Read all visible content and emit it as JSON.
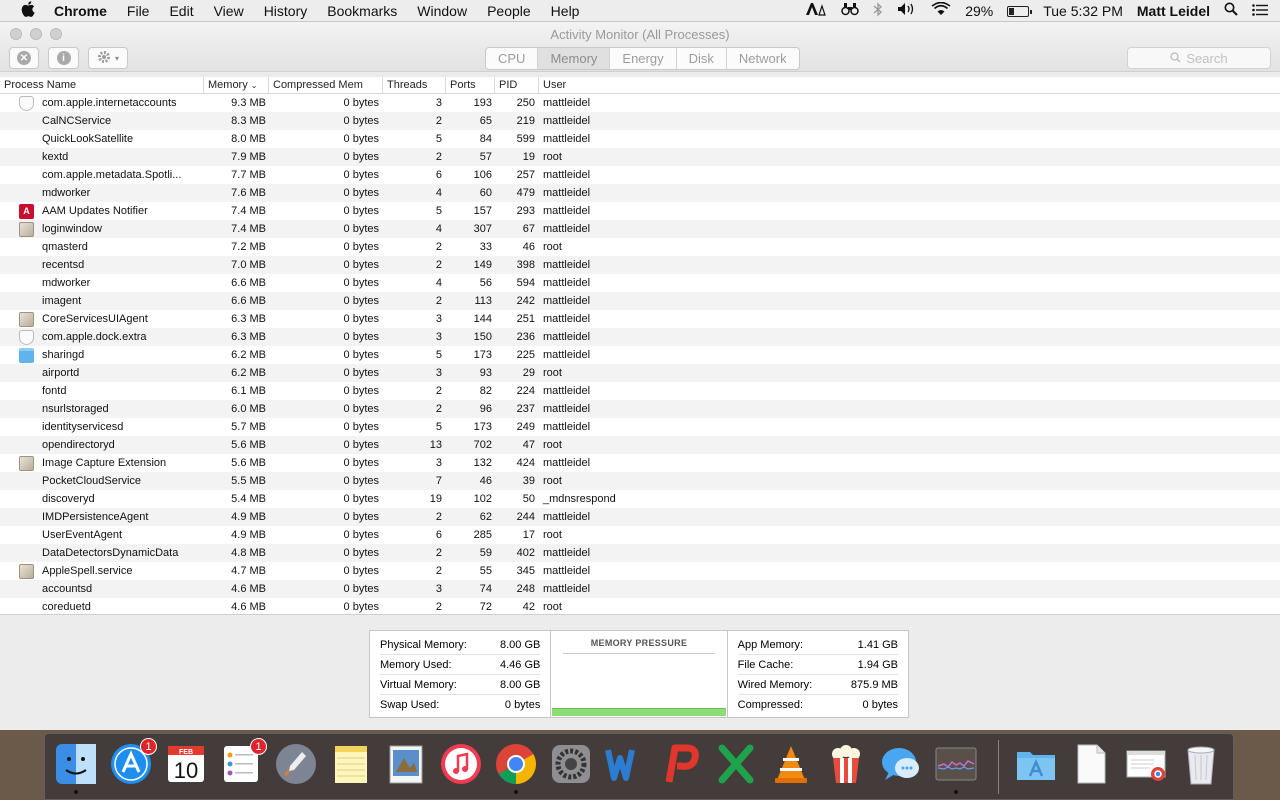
{
  "menubar": {
    "app": "Chrome",
    "items": [
      "File",
      "Edit",
      "View",
      "History",
      "Bookmarks",
      "Window",
      "People",
      "Help"
    ],
    "battery": "29%",
    "battery_level": 0.29,
    "clock": "Tue 5:32 PM",
    "user": "Matt Leidel"
  },
  "window": {
    "title": "Activity Monitor (All Processes)",
    "tabs": [
      "CPU",
      "Memory",
      "Energy",
      "Disk",
      "Network"
    ],
    "active_tab": "Memory",
    "search_placeholder": "Search"
  },
  "table": {
    "columns": {
      "process": "Process Name",
      "memory": "Memory",
      "compressed": "Compressed Mem",
      "threads": "Threads",
      "ports": "Ports",
      "pid": "PID",
      "user": "User"
    },
    "rows": [
      {
        "icon": "shield-icon",
        "name": "com.apple.internetaccounts",
        "memory": "9.3 MB",
        "compressed": "0 bytes",
        "threads": "3",
        "ports": "193",
        "pid": "250",
        "user": "mattleidel"
      },
      {
        "icon": "",
        "name": "CalNCService",
        "memory": "8.3 MB",
        "compressed": "0 bytes",
        "threads": "2",
        "ports": "65",
        "pid": "219",
        "user": "mattleidel"
      },
      {
        "icon": "",
        "name": "QuickLookSatellite",
        "memory": "8.0 MB",
        "compressed": "0 bytes",
        "threads": "5",
        "ports": "84",
        "pid": "599",
        "user": "mattleidel"
      },
      {
        "icon": "",
        "name": "kextd",
        "memory": "7.9 MB",
        "compressed": "0 bytes",
        "threads": "2",
        "ports": "57",
        "pid": "19",
        "user": "root"
      },
      {
        "icon": "",
        "name": "com.apple.metadata.Spotli...",
        "memory": "7.7 MB",
        "compressed": "0 bytes",
        "threads": "6",
        "ports": "106",
        "pid": "257",
        "user": "mattleidel"
      },
      {
        "icon": "",
        "name": "mdworker",
        "memory": "7.6 MB",
        "compressed": "0 bytes",
        "threads": "4",
        "ports": "60",
        "pid": "479",
        "user": "mattleidel"
      },
      {
        "icon": "adobe-icon",
        "name": "AAM Updates Notifier",
        "memory": "7.4 MB",
        "compressed": "0 bytes",
        "threads": "5",
        "ports": "157",
        "pid": "293",
        "user": "mattleidel"
      },
      {
        "icon": "app-icon",
        "name": "loginwindow",
        "memory": "7.4 MB",
        "compressed": "0 bytes",
        "threads": "4",
        "ports": "307",
        "pid": "67",
        "user": "mattleidel"
      },
      {
        "icon": "",
        "name": "qmasterd",
        "memory": "7.2 MB",
        "compressed": "0 bytes",
        "threads": "2",
        "ports": "33",
        "pid": "46",
        "user": "root"
      },
      {
        "icon": "",
        "name": "recentsd",
        "memory": "7.0 MB",
        "compressed": "0 bytes",
        "threads": "2",
        "ports": "149",
        "pid": "398",
        "user": "mattleidel"
      },
      {
        "icon": "",
        "name": "mdworker",
        "memory": "6.6 MB",
        "compressed": "0 bytes",
        "threads": "4",
        "ports": "56",
        "pid": "594",
        "user": "mattleidel"
      },
      {
        "icon": "",
        "name": "imagent",
        "memory": "6.6 MB",
        "compressed": "0 bytes",
        "threads": "2",
        "ports": "113",
        "pid": "242",
        "user": "mattleidel"
      },
      {
        "icon": "app-icon",
        "name": "CoreServicesUIAgent",
        "memory": "6.3 MB",
        "compressed": "0 bytes",
        "threads": "3",
        "ports": "144",
        "pid": "251",
        "user": "mattleidel"
      },
      {
        "icon": "shield-icon",
        "name": "com.apple.dock.extra",
        "memory": "6.3 MB",
        "compressed": "0 bytes",
        "threads": "3",
        "ports": "150",
        "pid": "236",
        "user": "mattleidel"
      },
      {
        "icon": "folder-icon",
        "name": "sharingd",
        "memory": "6.2 MB",
        "compressed": "0 bytes",
        "threads": "5",
        "ports": "173",
        "pid": "225",
        "user": "mattleidel"
      },
      {
        "icon": "",
        "name": "airportd",
        "memory": "6.2 MB",
        "compressed": "0 bytes",
        "threads": "3",
        "ports": "93",
        "pid": "29",
        "user": "root"
      },
      {
        "icon": "",
        "name": "fontd",
        "memory": "6.1 MB",
        "compressed": "0 bytes",
        "threads": "2",
        "ports": "82",
        "pid": "224",
        "user": "mattleidel"
      },
      {
        "icon": "",
        "name": "nsurlstoraged",
        "memory": "6.0 MB",
        "compressed": "0 bytes",
        "threads": "2",
        "ports": "96",
        "pid": "237",
        "user": "mattleidel"
      },
      {
        "icon": "",
        "name": "identityservicesd",
        "memory": "5.7 MB",
        "compressed": "0 bytes",
        "threads": "5",
        "ports": "173",
        "pid": "249",
        "user": "mattleidel"
      },
      {
        "icon": "",
        "name": "opendirectoryd",
        "memory": "5.6 MB",
        "compressed": "0 bytes",
        "threads": "13",
        "ports": "702",
        "pid": "47",
        "user": "root"
      },
      {
        "icon": "app-icon",
        "name": "Image Capture Extension",
        "memory": "5.6 MB",
        "compressed": "0 bytes",
        "threads": "3",
        "ports": "132",
        "pid": "424",
        "user": "mattleidel"
      },
      {
        "icon": "",
        "name": "PocketCloudService",
        "memory": "5.5 MB",
        "compressed": "0 bytes",
        "threads": "7",
        "ports": "46",
        "pid": "39",
        "user": "root"
      },
      {
        "icon": "",
        "name": "discoveryd",
        "memory": "5.4 MB",
        "compressed": "0 bytes",
        "threads": "19",
        "ports": "102",
        "pid": "50",
        "user": "_mdnsrespond"
      },
      {
        "icon": "",
        "name": "IMDPersistenceAgent",
        "memory": "4.9 MB",
        "compressed": "0 bytes",
        "threads": "2",
        "ports": "62",
        "pid": "244",
        "user": "mattleidel"
      },
      {
        "icon": "",
        "name": "UserEventAgent",
        "memory": "4.9 MB",
        "compressed": "0 bytes",
        "threads": "6",
        "ports": "285",
        "pid": "17",
        "user": "root"
      },
      {
        "icon": "",
        "name": "DataDetectorsDynamicData",
        "memory": "4.8 MB",
        "compressed": "0 bytes",
        "threads": "2",
        "ports": "59",
        "pid": "402",
        "user": "mattleidel"
      },
      {
        "icon": "app-icon",
        "name": "AppleSpell.service",
        "memory": "4.7 MB",
        "compressed": "0 bytes",
        "threads": "2",
        "ports": "55",
        "pid": "345",
        "user": "mattleidel"
      },
      {
        "icon": "",
        "name": "accountsd",
        "memory": "4.6 MB",
        "compressed": "0 bytes",
        "threads": "3",
        "ports": "74",
        "pid": "248",
        "user": "mattleidel"
      },
      {
        "icon": "",
        "name": "coreduetd",
        "memory": "4.6 MB",
        "compressed": "0 bytes",
        "threads": "2",
        "ports": "72",
        "pid": "42",
        "user": "root"
      }
    ]
  },
  "memory_stats": {
    "left": [
      {
        "label": "Physical Memory:",
        "value": "8.00 GB"
      },
      {
        "label": "Memory Used:",
        "value": "4.46 GB"
      },
      {
        "label": "Virtual Memory:",
        "value": "8.00 GB"
      },
      {
        "label": "Swap Used:",
        "value": "0 bytes"
      }
    ],
    "pressure_title": "MEMORY PRESSURE",
    "pressure_color": "#8ddc7a",
    "right": [
      {
        "label": "App Memory:",
        "value": "1.41 GB"
      },
      {
        "label": "File Cache:",
        "value": "1.94 GB"
      },
      {
        "label": "Wired Memory:",
        "value": "875.9 MB"
      },
      {
        "label": "Compressed:",
        "value": "0 bytes"
      }
    ]
  },
  "dock": {
    "calendar_month": "FEB",
    "calendar_day": "10",
    "app_store_badge": "1",
    "reminders_badge": "1",
    "items": [
      "finder-icon",
      "app-store-icon",
      "calendar-icon",
      "reminders-icon",
      "launchpad-icon",
      "notes-icon",
      "preview-icon",
      "itunes-icon",
      "chrome-icon",
      "system-preferences-icon",
      "word-icon",
      "powerpoint-icon",
      "excel-icon",
      "vlc-icon",
      "popcorn-time-icon",
      "messages-icon",
      "activity-monitor-icon",
      "applications-folder-icon",
      "document-icon",
      "chrome-document-icon",
      "trash-icon"
    ]
  }
}
